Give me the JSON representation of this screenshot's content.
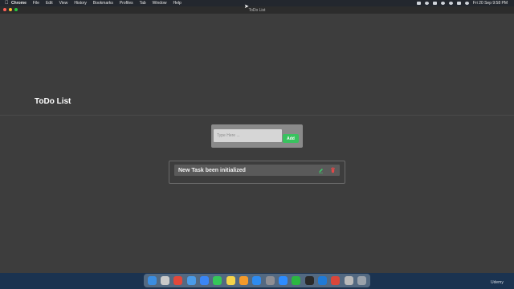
{
  "menubar": {
    "app": "Chrome",
    "items": [
      "File",
      "Edit",
      "View",
      "History",
      "Bookmarks",
      "Profiles",
      "Tab",
      "Window",
      "Help"
    ],
    "clock": "Fri 20 Sep  9:58 PM"
  },
  "window": {
    "title": "ToDo List"
  },
  "page": {
    "heading": "ToDo List"
  },
  "form": {
    "placeholder": "Type Here ...",
    "add_label": "Add"
  },
  "tasks": [
    {
      "text": "New Task been initialized"
    }
  ],
  "dock": {
    "apps": [
      {
        "name": "finder-icon",
        "color": "#3b8de0"
      },
      {
        "name": "launchpad-icon",
        "color": "#c9c9c9"
      },
      {
        "name": "chrome-icon",
        "color": "#e2483a"
      },
      {
        "name": "safari-icon",
        "color": "#4a9be8"
      },
      {
        "name": "mail-icon",
        "color": "#3a86f5"
      },
      {
        "name": "messages-icon",
        "color": "#35c759"
      },
      {
        "name": "notes-icon",
        "color": "#f5d34a"
      },
      {
        "name": "pages-icon",
        "color": "#f39a2b"
      },
      {
        "name": "app-store-icon",
        "color": "#2e8bf0"
      },
      {
        "name": "settings-icon",
        "color": "#8e8e93"
      },
      {
        "name": "zoom-icon",
        "color": "#2d8cff"
      },
      {
        "name": "whatsapp-icon",
        "color": "#2bb741"
      },
      {
        "name": "terminal-icon",
        "color": "#2a2a2a"
      },
      {
        "name": "vscode-icon",
        "color": "#1f7ad6"
      },
      {
        "name": "chrome-alt-icon",
        "color": "#d9463a"
      },
      {
        "name": "preview-icon",
        "color": "#b9b9b9"
      },
      {
        "name": "trash-icon",
        "color": "#9aa2ab"
      }
    ]
  },
  "watermark": "Udemy",
  "colors": {
    "accent_green": "#39c25f",
    "delete_red": "#e04848",
    "edit_green": "#3ccf6a",
    "page_bg": "#3d3d3d"
  }
}
